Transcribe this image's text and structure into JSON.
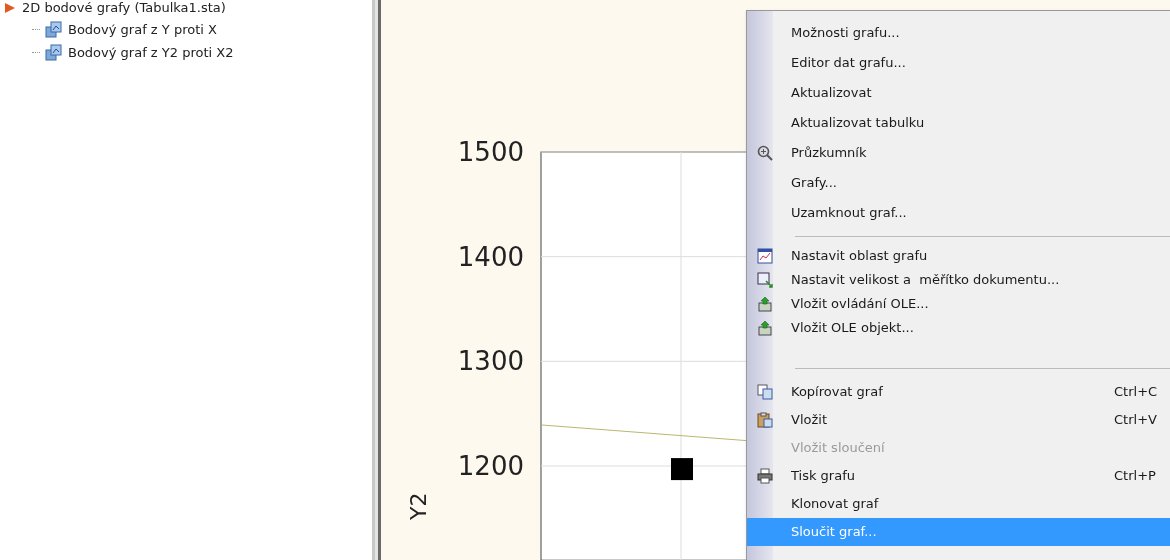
{
  "tree": {
    "root": {
      "label": "2D bodové grafy (Tabulka1.sta)",
      "expanded": true,
      "children": [
        {
          "label": "Bodový graf z Y proti X"
        },
        {
          "label": "Bodový graf z Y2 proti X2"
        }
      ]
    }
  },
  "chart": {
    "chart_data": {
      "type": "scatter",
      "ylabel": "Y2",
      "ylim": [
        1110,
        1500
      ],
      "yticks": [
        1200,
        1300,
        1400,
        1500
      ],
      "grid": true,
      "series": [
        {
          "color": "#000000",
          "values": [
            1198
          ]
        }
      ]
    }
  },
  "context_menu": {
    "items": [
      {
        "kind": "item",
        "label": "Možnosti grafu...",
        "disabled": false,
        "selected": false
      },
      {
        "kind": "item",
        "label": "Editor dat grafu...",
        "disabled": false,
        "selected": false
      },
      {
        "kind": "item",
        "label": "Aktualizovat",
        "disabled": false,
        "selected": false
      },
      {
        "kind": "item",
        "label": "Aktualizovat tabulku",
        "disabled": false,
        "selected": false
      },
      {
        "kind": "item",
        "label": "Průzkumník",
        "disabled": false,
        "selected": false
      },
      {
        "kind": "item",
        "label": "Grafy...",
        "disabled": false,
        "selected": false
      },
      {
        "kind": "item",
        "label": "Uzamknout graf...",
        "disabled": false,
        "selected": false
      },
      {
        "kind": "separator"
      },
      {
        "kind": "item",
        "label": "Nastavit oblast grafu",
        "disabled": false,
        "selected": false
      },
      {
        "kind": "item",
        "label": "Nastavit velikost a  měřítko dokumentu...",
        "disabled": false,
        "selected": false
      },
      {
        "kind": "item",
        "label": "Vložit ovládání OLE...",
        "disabled": false,
        "selected": false
      },
      {
        "kind": "item",
        "label": "Vložit OLE objekt...",
        "disabled": false,
        "selected": false
      },
      {
        "kind": "separator"
      },
      {
        "kind": "item",
        "label": "Kopírovat graf",
        "shortcut": "Ctrl+C",
        "disabled": false,
        "selected": false
      },
      {
        "kind": "item",
        "label": "Vložit",
        "shortcut": "Ctrl+V",
        "disabled": false,
        "selected": false
      },
      {
        "kind": "item",
        "label": "Vložit sloučení",
        "disabled": true,
        "selected": false
      },
      {
        "kind": "item",
        "label": "Tisk grafu",
        "shortcut": "Ctrl+P",
        "disabled": false,
        "selected": false
      },
      {
        "kind": "item",
        "label": "Klonovat graf",
        "disabled": false,
        "selected": false
      },
      {
        "kind": "item",
        "label": "Sloučit graf...",
        "disabled": false,
        "selected": true
      }
    ]
  }
}
